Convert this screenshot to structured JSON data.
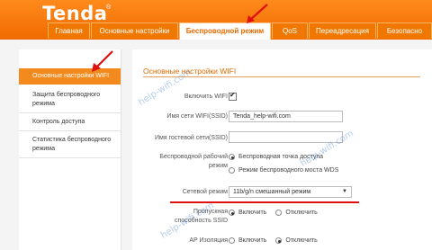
{
  "brand": {
    "logo": "Tenda",
    "logo_mark": "®"
  },
  "tabs": [
    {
      "label": "Главная"
    },
    {
      "label": "Основные настройки"
    },
    {
      "label": "Беспроводной режим"
    },
    {
      "label": "QoS"
    },
    {
      "label": "Переадресация"
    },
    {
      "label": "Безопасно"
    }
  ],
  "sidebar": {
    "items": [
      {
        "label": "Основные настройки WIFI"
      },
      {
        "label": "Защита беспроводного режима"
      },
      {
        "label": "Контроль доступа"
      },
      {
        "label": "Статистика беспроводного режима"
      }
    ]
  },
  "main": {
    "title": "Основные настройки WIFI",
    "enable_wifi": {
      "label": "Включить WIFI",
      "checked": true
    },
    "ssid": {
      "label": "Имя сети WIFI(SSID)",
      "value": "Tenda_help-wifi.com"
    },
    "guest_ssid": {
      "label": "Имя гостевой сети(SSID)",
      "value": ""
    },
    "work_mode": {
      "label": "Беспроводной рабочий режим",
      "options": [
        "Беспроводная точка доступа",
        "Режим беспроводного моста WDS"
      ],
      "selected": 0
    },
    "net_mode": {
      "label": "Сетевой режим",
      "value": "11b/g/n смешанный режим"
    },
    "bandwidth": {
      "label": "Пропускная способность SSID",
      "on": "Включить",
      "off": "Отключить",
      "selected": "on"
    },
    "ap_isolation": {
      "label": "AP Изоляция",
      "on": "Включить",
      "off": "Отключить",
      "selected": "off"
    }
  },
  "watermark": {
    "text": "help-wifi.com"
  },
  "colors": {
    "brand_orange": "#f07800",
    "highlight_red": "#e01010"
  }
}
